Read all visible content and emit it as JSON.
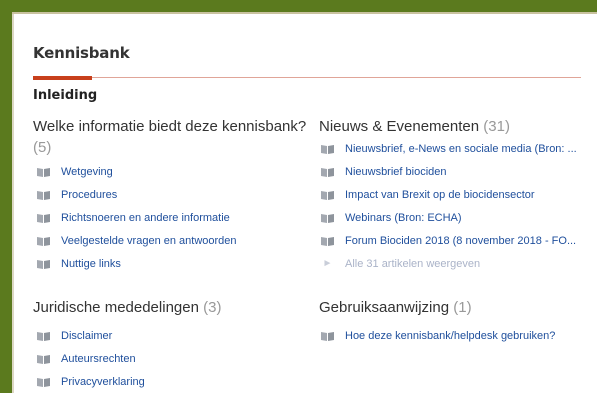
{
  "header": {
    "title": "Kennisbank"
  },
  "section": {
    "title": "Inleiding"
  },
  "categories": [
    {
      "title": "Welke informatie biedt deze kennisbank?",
      "count": "(5)",
      "items": [
        "Wetgeving",
        "Procedures",
        "Richtsnoeren en andere informatie",
        "Veelgestelde vragen en antwoorden",
        "Nuttige links"
      ]
    },
    {
      "title": "Nieuws & Evenementen",
      "count": "(31)",
      "items": [
        "Nieuwsbrief, e-News en sociale media (Bron: ...",
        "Nieuwsbrief biociden",
        "Impact van Brexit op de biocidensector",
        "Webinars (Bron: ECHA)",
        "Forum Biociden 2018 (8 november 2018 - FO..."
      ],
      "more": "Alle 31 artikelen weergeven"
    },
    {
      "title": "Juridische mededelingen",
      "count": "(3)",
      "items": [
        "Disclaimer",
        "Auteursrechten",
        "Privacyverklaring"
      ]
    },
    {
      "title": "Gebruiksaanwijzing",
      "count": "(1)",
      "items": [
        "Hoe deze kennisbank/helpdesk gebruiken?"
      ]
    }
  ],
  "colors": {
    "frame": "#5b7a1e",
    "accent": "#c8401c",
    "link": "#1f4f9c"
  },
  "icons": {
    "article": "book-icon",
    "more": "arrow-right-icon"
  }
}
